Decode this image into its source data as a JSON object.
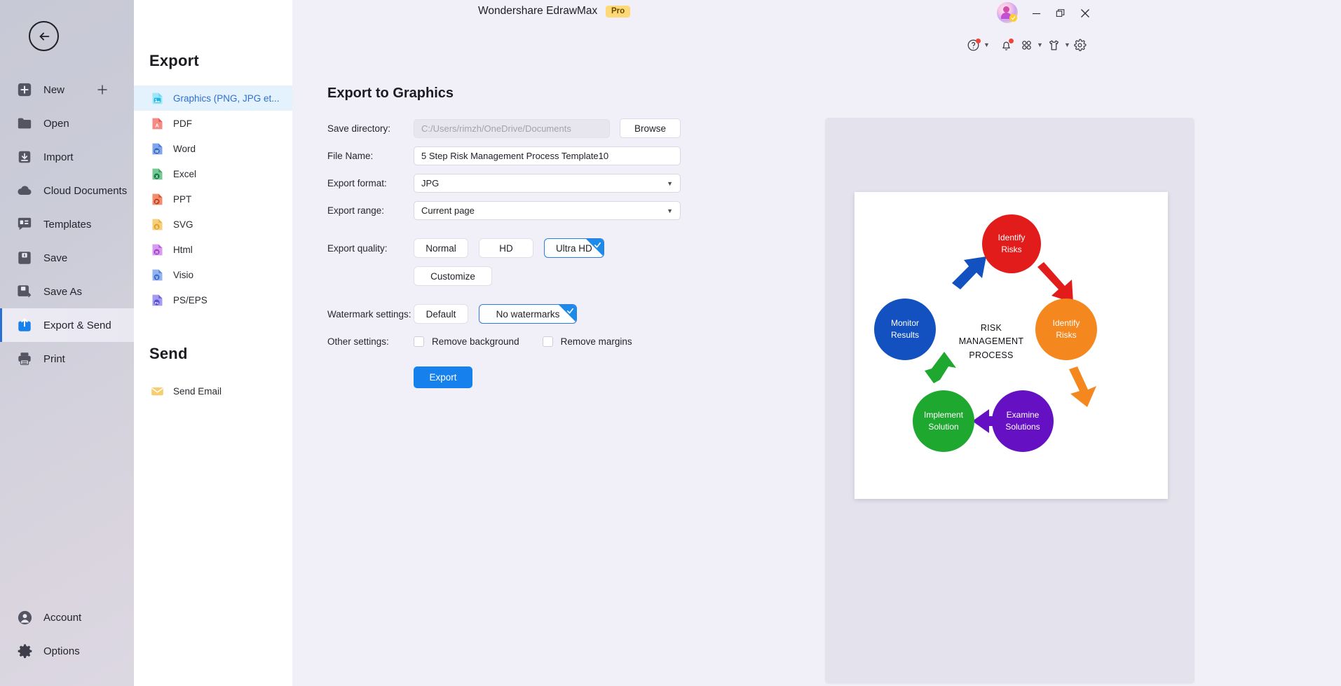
{
  "window": {
    "app_title": "Wondershare EdrawMax",
    "pro_badge": "Pro",
    "minimize": "minimize",
    "maximize": "restore",
    "close": "close"
  },
  "toolbar": {
    "help": "help",
    "notifications": "notifications",
    "apps": "apps",
    "themes": "themes",
    "settings": "settings"
  },
  "rail": {
    "back": "back",
    "items": [
      {
        "label": "New",
        "icon": "new-icon"
      },
      {
        "label": "Open",
        "icon": "folder-icon"
      },
      {
        "label": "Import",
        "icon": "import-icon"
      },
      {
        "label": "Cloud Documents",
        "icon": "cloud-icon"
      },
      {
        "label": "Templates",
        "icon": "templates-icon"
      },
      {
        "label": "Save",
        "icon": "save-icon"
      },
      {
        "label": "Save As",
        "icon": "save-as-icon"
      },
      {
        "label": "Export & Send",
        "icon": "export-send-icon"
      },
      {
        "label": "Print",
        "icon": "print-icon"
      }
    ],
    "bottom_items": [
      {
        "label": "Account",
        "icon": "account-icon"
      },
      {
        "label": "Options",
        "icon": "gear-icon"
      }
    ]
  },
  "midpanel": {
    "export_heading": "Export",
    "send_heading": "Send",
    "export_items": [
      {
        "label": "Graphics (PNG, JPG et...",
        "icon": "image-file-icon",
        "color": "#39bdf0"
      },
      {
        "label": "PDF",
        "icon": "pdf-file-icon",
        "color": "#e8524a"
      },
      {
        "label": "Word",
        "icon": "word-file-icon",
        "color": "#3b6fd4"
      },
      {
        "label": "Excel",
        "icon": "excel-file-icon",
        "color": "#1d9254"
      },
      {
        "label": "PPT",
        "icon": "ppt-file-icon",
        "color": "#e8552c"
      },
      {
        "label": "SVG",
        "icon": "svg-file-icon",
        "color": "#f0b429"
      },
      {
        "label": "Html",
        "icon": "html-file-icon",
        "color": "#b14fe0"
      },
      {
        "label": "Visio",
        "icon": "visio-file-icon",
        "color": "#4f83e0"
      },
      {
        "label": "PS/EPS",
        "icon": "ps-eps-file-icon",
        "color": "#6a5ae0"
      }
    ],
    "send_items": [
      {
        "label": "Send Email",
        "icon": "envelope-icon",
        "color": "#f5b63c"
      }
    ]
  },
  "main": {
    "page_title": "Export to Graphics",
    "labels": {
      "save_directory": "Save directory:",
      "file_name": "File Name:",
      "export_format": "Export format:",
      "export_range": "Export range:",
      "export_quality": "Export quality:",
      "watermark_settings": "Watermark settings:",
      "other_settings": "Other settings:"
    },
    "save_directory_value": "C:/Users/rimzh/OneDrive/Documents",
    "browse_label": "Browse",
    "file_name_value": "5 Step Risk Management Process Template10",
    "export_format_value": "JPG",
    "export_range_value": "Current page",
    "quality_options": [
      {
        "label": "Normal",
        "selected": false
      },
      {
        "label": "HD",
        "selected": false
      },
      {
        "label": "Ultra HD",
        "selected": true
      }
    ],
    "customize_label": "Customize",
    "watermark_options": [
      {
        "label": "Default",
        "selected": false
      },
      {
        "label": "No watermarks",
        "selected": true
      }
    ],
    "other_settings_options": [
      {
        "label": "Remove background",
        "checked": false
      },
      {
        "label": "Remove margins",
        "checked": false
      }
    ],
    "export_button": "Export",
    "accent_color": "#1681ed"
  },
  "preview": {
    "diagram": {
      "center_label": "RISK MANAGEMENT PROCESS",
      "nodes": [
        {
          "id": "red",
          "lines": [
            "Identify",
            "Risks"
          ],
          "color": "#e21b1b"
        },
        {
          "id": "orange",
          "lines": [
            "Identify",
            "Risks"
          ],
          "color": "#f5871f"
        },
        {
          "id": "purple",
          "lines": [
            "Examine",
            "Solutions"
          ],
          "color": "#6610c4"
        },
        {
          "id": "green",
          "lines": [
            "Implement",
            "Solution"
          ],
          "color": "#1fa82f"
        },
        {
          "id": "blue",
          "lines": [
            "Monitor",
            "Results"
          ],
          "color": "#1350c0"
        }
      ],
      "arrows": [
        {
          "from": "red",
          "to": "orange",
          "color": "#e21b1b"
        },
        {
          "from": "orange",
          "to": "purple",
          "color": "#f5871f"
        },
        {
          "from": "purple",
          "to": "green",
          "color": "#6610c4"
        },
        {
          "from": "green",
          "to": "blue",
          "color": "#1fa82f"
        },
        {
          "from": "blue",
          "to": "red",
          "color": "#1350c0"
        }
      ]
    }
  }
}
